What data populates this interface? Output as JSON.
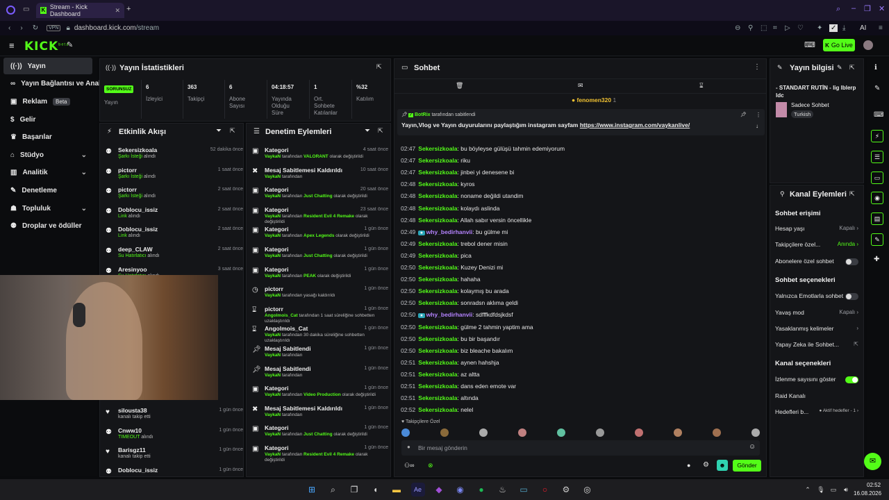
{
  "browser": {
    "tab_title": "Stream - Kick Dashboard",
    "url_host": "dashboard.kick.com",
    "url_path": "/stream",
    "vpn": "VPN",
    "ai": "AI"
  },
  "brand": {
    "logo": "KICK",
    "logo_sup": "beta",
    "accent": "#53fc18"
  },
  "header": {
    "go_live": "Go Live"
  },
  "sidebar": {
    "items": [
      {
        "label": "Yayın",
        "icon": "broadcast-icon"
      },
      {
        "label": "Yayın Bağlantısı ve Anahtarı",
        "icon": "link-icon"
      },
      {
        "label": "Reklam",
        "icon": "ad-icon",
        "badge": "Beta"
      },
      {
        "label": "Gelir",
        "icon": "money-icon"
      },
      {
        "label": "Başarılar",
        "icon": "trophy-icon"
      },
      {
        "label": "Stüdyo",
        "icon": "studio-icon",
        "chevron": true
      },
      {
        "label": "Analitik",
        "icon": "chart-icon",
        "chevron": true
      },
      {
        "label": "Denetleme",
        "icon": "wrench-icon"
      },
      {
        "label": "Topluluk",
        "icon": "community-icon",
        "chevron": true
      },
      {
        "label": "Droplar ve ödüller",
        "icon": "gift-icon"
      }
    ]
  },
  "stats": {
    "title": "Yayın İstatistikleri",
    "status": "SORUNSUZ",
    "status_label": "Yayın",
    "items": [
      {
        "value": "6",
        "label": "İzleyici"
      },
      {
        "value": "363",
        "label": "Takipçi"
      },
      {
        "value": "6",
        "label": "Abone Sayısı"
      },
      {
        "value": "04:18:57",
        "label": "Yayında Olduğu Süre"
      },
      {
        "value": "1",
        "label": "Ort. Sohbete Katılanlar"
      },
      {
        "value": "%32",
        "label": "Katılım"
      }
    ]
  },
  "activity": {
    "title": "Etkinlik Akışı",
    "events": [
      {
        "name": "Sekersizkoala",
        "hl": "Şarkı İsteği",
        "rest": " alındı",
        "time": "52 dakika önce"
      },
      {
        "name": "pictorr",
        "hl": "Şarkı İsteği",
        "rest": " alındı",
        "time": "1 saat önce"
      },
      {
        "name": "pictorr",
        "hl": "Şarkı İsteği",
        "rest": " alındı",
        "time": "2 saat önce"
      },
      {
        "name": "Doblocu_issiz",
        "hl": "Link",
        "rest": " alındı",
        "time": "2 saat önce"
      },
      {
        "name": "Doblocu_issiz",
        "hl": "Link",
        "rest": " alındı",
        "time": "2 saat önce"
      },
      {
        "name": "deep_CLAW",
        "hl": "Su Hatırlatıcı",
        "rest": " alındı",
        "time": "2 saat önce"
      },
      {
        "name": "Aresinyoo",
        "hl": "Su Hatırlatıcı",
        "rest": " alındı",
        "time": "3 saat önce"
      }
    ],
    "bottom_events": [
      {
        "name": "silousta38",
        "hl": "",
        "rest": "kanalı takip etti",
        "time": "1 gün önce",
        "icon": "heart-icon"
      },
      {
        "name": "Cnww10",
        "hl": "TIMEOUT",
        "rest": " alındı",
        "time": "1 gün önce",
        "icon": "gift-icon"
      },
      {
        "name": "Barisgz11",
        "hl": "",
        "rest": "kanalı takip etti",
        "time": "1 gün önce",
        "icon": "heart-icon"
      },
      {
        "name": "Doblocu_issiz",
        "hl": "",
        "rest": "",
        "time": "1 gün önce",
        "icon": "gift-icon"
      }
    ]
  },
  "moderation": {
    "title": "Denetim Eylemleri",
    "items": [
      {
        "title": "Kategori",
        "by": "VaykaN",
        "mid": " tarafından ",
        "hl": "VALORANT",
        "rest": " olarak değiştirildi",
        "time": "4 saat önce",
        "icon": "category-icon"
      },
      {
        "title": "Mesaj Sabitlemesi Kaldırıldı",
        "by": "VaykaN",
        "mid": " tarafından",
        "hl": "",
        "rest": "",
        "time": "10 saat önce",
        "icon": "unpin-icon"
      },
      {
        "title": "Kategori",
        "by": "VaykaN",
        "mid": " tarafından ",
        "hl": "Just Chatting",
        "rest": " olarak değiştirildi",
        "time": "20 saat önce",
        "icon": "category-icon"
      },
      {
        "title": "Kategori",
        "by": "VaykaN",
        "mid": " tarafından ",
        "hl": "Resident Evil 4 Remake",
        "rest": " olarak değiştirildi",
        "time": "23 saat önce",
        "icon": "category-icon"
      },
      {
        "title": "Kategori",
        "by": "VaykaN",
        "mid": " tarafından ",
        "hl": "Apex Legends",
        "rest": " olarak değiştirildi",
        "time": "1 gün önce",
        "icon": "category-icon"
      },
      {
        "title": "Kategori",
        "by": "VaykaN",
        "mid": " tarafından ",
        "hl": "Just Chatting",
        "rest": " olarak değiştirildi",
        "time": "1 gün önce",
        "icon": "category-icon"
      },
      {
        "title": "Kategori",
        "by": "VaykaN",
        "mid": " tarafından ",
        "hl": "PEAK",
        "rest": " olarak değiştirildi",
        "time": "1 gün önce",
        "icon": "category-icon"
      },
      {
        "title": "pictorr",
        "by": "VaykaN",
        "mid": " tarafından yasağı kaldırıldı",
        "hl": "",
        "rest": "",
        "time": "1 gün önce",
        "icon": "clock-icon"
      },
      {
        "title": "pictorr",
        "by": "Angolmois_Cat",
        "mid": " tarafından 1 saat süreliğine sohbetten uzaklaştırıldı",
        "hl": "",
        "rest": "",
        "time": "1 gün önce",
        "icon": "hourglass-icon"
      },
      {
        "title": "Angolmois_Cat",
        "by": "VaykaN",
        "mid": " tarafından 30 dakika süreliğine sohbetten uzaklaştırıldı",
        "hl": "",
        "rest": "",
        "time": "1 gün önce",
        "icon": "hourglass-icon"
      },
      {
        "title": "Mesaj Sabitlendi",
        "by": "VaykaN",
        "mid": " tarafından",
        "hl": "",
        "rest": "",
        "time": "1 gün önce",
        "icon": "pin-icon"
      },
      {
        "title": "Mesaj Sabitlendi",
        "by": "VaykaN",
        "mid": " tarafından",
        "hl": "",
        "rest": "",
        "time": "1 gün önce",
        "icon": "pin-icon"
      },
      {
        "title": "Kategori",
        "by": "VaykaN",
        "mid": " tarafından ",
        "hl": "Video Production",
        "rest": " olarak değiştirildi",
        "time": "1 gün önce",
        "icon": "category-icon"
      },
      {
        "title": "Mesaj Sabitlemesi Kaldırıldı",
        "by": "VaykaN",
        "mid": " tarafından",
        "hl": "",
        "rest": "",
        "time": "1 gün önce",
        "icon": "unpin-icon"
      },
      {
        "title": "Kategori",
        "by": "VaykaN",
        "mid": " tarafından ",
        "hl": "Just Chatting",
        "rest": " olarak değiştirildi",
        "time": "1 gün önce",
        "icon": "category-icon"
      },
      {
        "title": "Kategori",
        "by": "VaykaN",
        "mid": " tarafından ",
        "hl": "Resident Evil 4 Remake",
        "rest": " olarak değiştirildi",
        "time": "1 gün önce",
        "icon": "category-icon"
      }
    ]
  },
  "chat": {
    "title": "Sohbet",
    "top_user": "fenomen320",
    "top_count": "1",
    "pinned": {
      "by": "BotRix",
      "by_suffix": " tarafından sabitlendi",
      "text": "Yayın,Vlog ve Yayın duyurularını paylaştığım instagram sayfam ",
      "link": "https://www.instagram.com/vaykanlive/"
    },
    "messages": [
      {
        "time": "02:47",
        "user": "Sekersizkoala",
        "text": "bu böyleyse gülüşü tahmin edemiyorum"
      },
      {
        "time": "02:47",
        "user": "Sekersizkoala",
        "text": "riku"
      },
      {
        "time": "02:47",
        "user": "Sekersizkoala",
        "text": "jinbei yi denesene bi"
      },
      {
        "time": "02:48",
        "user": "Sekersizkoala",
        "text": "kyros"
      },
      {
        "time": "02:48",
        "user": "Sekersizkoala",
        "text": "noname değildi utandim"
      },
      {
        "time": "02:48",
        "user": "Sekersizkoala",
        "text": "kolaydı aslinda"
      },
      {
        "time": "02:48",
        "user": "Sekersizkoala",
        "text": "Allah sabır versin öncellikle"
      },
      {
        "time": "02:49",
        "user": "why_bedirhanvii",
        "text": "bu gülme mi",
        "alt": true
      },
      {
        "time": "02:49",
        "user": "Sekersizkoala",
        "text": "trebol dener misin"
      },
      {
        "time": "02:49",
        "user": "Sekersizkoala",
        "text": "pica"
      },
      {
        "time": "02:50",
        "user": "Sekersizkoala",
        "text": "Kuzey Denizi mi"
      },
      {
        "time": "02:50",
        "user": "Sekersizkoala",
        "text": "hahaha"
      },
      {
        "time": "02:50",
        "user": "Sekersizkoala",
        "text": "kolaymış bu arada"
      },
      {
        "time": "02:50",
        "user": "Sekersizkoala",
        "text": "sonradsn aklıma geldi"
      },
      {
        "time": "02:50",
        "user": "why_bedirhanvii",
        "text": "sdfffkdfdsjkdsf",
        "alt": true
      },
      {
        "time": "02:50",
        "user": "Sekersizkoala",
        "text": "gülme 2 tahmin yaptim ama"
      },
      {
        "time": "02:50",
        "user": "Sekersizkoala",
        "text": "bu bir başandır"
      },
      {
        "time": "02:50",
        "user": "Sekersizkoala",
        "text": "biz bleache bakalım"
      },
      {
        "time": "02:51",
        "user": "Sekersizkoala",
        "text": "aynen hahshja"
      },
      {
        "time": "02:51",
        "user": "Sekersizkoala",
        "text": "az altta"
      },
      {
        "time": "02:51",
        "user": "Sekersizkoala",
        "text": "dans eden emote var"
      },
      {
        "time": "02:51",
        "user": "Sekersizkoala",
        "text": "altında"
      },
      {
        "time": "02:52",
        "user": "Sekersizkoala",
        "text": "nelel"
      }
    ],
    "followers_only": "Takipçilere Özel",
    "input_placeholder": "Bir mesaj gönderin",
    "send": "Gönder"
  },
  "stream_info": {
    "title": "Yayın bilgisi",
    "stream_title": "- STANDART RUTİN - lig lblerp ldc",
    "category": "Sadece Sohbet",
    "language": "Turkish"
  },
  "channel_actions": {
    "title": "Kanal Eylemleri",
    "chat_access": {
      "heading": "Sohbet erişimi",
      "rows": [
        {
          "label": "Hesap yaşı",
          "value": "Kapalı"
        },
        {
          "label": "Takipçilere özel...",
          "value": "Anında"
        },
        {
          "label": "Abonelere özel sohbet",
          "toggle": false
        }
      ]
    },
    "chat_options": {
      "heading": "Sohbet seçenekleri",
      "rows": [
        {
          "label": "Yalnızca Emotlarla sohbet",
          "toggle": false
        },
        {
          "label": "Yavaş mod",
          "value": "Kapalı"
        },
        {
          "label": "Yasaklanmış kelimeler"
        },
        {
          "label": "Yapay Zeka ile Sohbet..."
        }
      ]
    },
    "channel_options": {
      "heading": "Kanal seçenekleri",
      "rows": [
        {
          "label": "İzlenme sayısını göster",
          "toggle": true
        },
        {
          "label": "Raid Kanalı"
        },
        {
          "label": "Hedefleri b...",
          "value": "Aktif hedefler - 1"
        }
      ]
    }
  },
  "taskbar": {
    "time": "02:52",
    "date": "16.08.2026"
  }
}
